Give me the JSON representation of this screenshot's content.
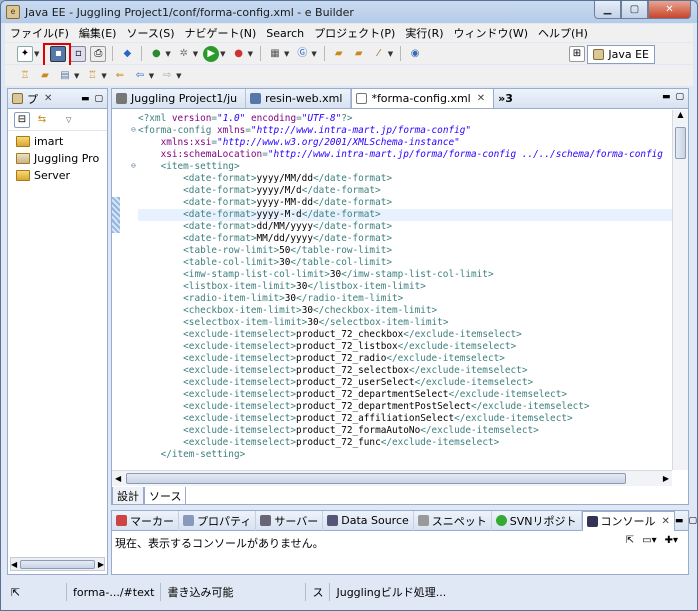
{
  "window": {
    "title": "Java EE - Juggling Project1/conf/forma-config.xml - e Builder"
  },
  "menu": [
    "ファイル(F)",
    "編集(E)",
    "ソース(S)",
    "ナビゲート(N)",
    "Search",
    "プロジェクト(P)",
    "実行(R)",
    "ウィンドウ(W)",
    "ヘルプ(H)"
  ],
  "perspective": {
    "label": "Java EE"
  },
  "explorer": {
    "tab_label": "プ",
    "items": [
      "imart",
      "Juggling Pro",
      "Server"
    ]
  },
  "editor": {
    "tabs": [
      {
        "label": "Juggling Project1/ju",
        "active": false
      },
      {
        "label": "resin-web.xml",
        "active": false
      },
      {
        "label": "*forma-config.xml",
        "active": true
      },
      {
        "label": "»3",
        "active": false
      }
    ],
    "lines": [
      [
        {
          "c": "t-tag",
          "t": "<?xml "
        },
        {
          "c": "t-attr",
          "t": "version"
        },
        {
          "c": "t-tag",
          "t": "="
        },
        {
          "c": "t-val",
          "t": "\"1.0\""
        },
        {
          "c": "t-tag",
          "t": " "
        },
        {
          "c": "t-attr",
          "t": "encoding"
        },
        {
          "c": "t-tag",
          "t": "="
        },
        {
          "c": "t-val",
          "t": "\"UTF-8\""
        },
        {
          "c": "t-tag",
          "t": "?>"
        }
      ],
      [
        {
          "c": "t-tag",
          "t": "<forma-config "
        },
        {
          "c": "t-attr",
          "t": "xmlns"
        },
        {
          "c": "t-tag",
          "t": "="
        },
        {
          "c": "t-val",
          "t": "\"http://www.intra-mart.jp/forma-config\""
        }
      ],
      [
        {
          "c": "t-txt",
          "t": "    "
        },
        {
          "c": "t-attr",
          "t": "xmlns:xsi"
        },
        {
          "c": "t-tag",
          "t": "="
        },
        {
          "c": "t-val",
          "t": "\"http://www.w3.org/2001/XMLSchema-instance\""
        }
      ],
      [
        {
          "c": "t-txt",
          "t": "    "
        },
        {
          "c": "t-attr",
          "t": "xsi:schemaLocation"
        },
        {
          "c": "t-tag",
          "t": "="
        },
        {
          "c": "t-val",
          "t": "\"http://www.intra-mart.jp/forma/forma-config ../../schema/forma-config"
        }
      ],
      [
        {
          "c": "t-txt",
          "t": "    "
        },
        {
          "c": "t-tag",
          "t": "<item-setting>"
        }
      ],
      [
        {
          "c": "t-txt",
          "t": "        "
        },
        {
          "c": "t-tag",
          "t": "<date-format>"
        },
        {
          "c": "t-txt",
          "t": "yyyy/MM/dd"
        },
        {
          "c": "t-tag",
          "t": "</date-format>"
        }
      ],
      [
        {
          "c": "t-txt",
          "t": "        "
        },
        {
          "c": "t-tag",
          "t": "<date-format>"
        },
        {
          "c": "t-txt",
          "t": "yyyy/M/d"
        },
        {
          "c": "t-tag",
          "t": "</date-format>"
        }
      ],
      [
        {
          "c": "t-txt",
          "t": "        "
        },
        {
          "c": "t-tag",
          "t": "<date-format>"
        },
        {
          "c": "t-txt",
          "t": "yyyy-MM-dd"
        },
        {
          "c": "t-tag",
          "t": "</date-format>"
        }
      ],
      [
        {
          "c": "t-txt",
          "t": "        "
        },
        {
          "c": "t-tag",
          "t": "<date-format>"
        },
        {
          "c": "t-txt",
          "t": "yyyy-M-d"
        },
        {
          "c": "t-tag",
          "t": "</date-format>"
        }
      ],
      [
        {
          "c": "t-txt",
          "t": "        "
        },
        {
          "c": "t-tag",
          "t": "<date-format>"
        },
        {
          "c": "t-txt",
          "t": "dd/MM/yyyy"
        },
        {
          "c": "t-tag",
          "t": "</date-format>"
        }
      ],
      [
        {
          "c": "t-txt",
          "t": "        "
        },
        {
          "c": "t-tag",
          "t": "<date-format>"
        },
        {
          "c": "t-txt",
          "t": "MM/dd/yyyy"
        },
        {
          "c": "t-tag",
          "t": "</date-format>"
        }
      ],
      [
        {
          "c": "t-txt",
          "t": "        "
        },
        {
          "c": "t-tag",
          "t": "<table-row-limit>"
        },
        {
          "c": "t-txt",
          "t": "50"
        },
        {
          "c": "t-tag",
          "t": "</table-row-limit>"
        }
      ],
      [
        {
          "c": "t-txt",
          "t": "        "
        },
        {
          "c": "t-tag",
          "t": "<table-col-limit>"
        },
        {
          "c": "t-txt",
          "t": "30"
        },
        {
          "c": "t-tag",
          "t": "</table-col-limit>"
        }
      ],
      [
        {
          "c": "t-txt",
          "t": "        "
        },
        {
          "c": "t-tag",
          "t": "<imw-stamp-list-col-limit>"
        },
        {
          "c": "t-txt",
          "t": "30"
        },
        {
          "c": "t-tag",
          "t": "</imw-stamp-list-col-limit>"
        }
      ],
      [
        {
          "c": "t-txt",
          "t": "        "
        },
        {
          "c": "t-tag",
          "t": "<listbox-item-limit>"
        },
        {
          "c": "t-txt",
          "t": "30"
        },
        {
          "c": "t-tag",
          "t": "</listbox-item-limit>"
        }
      ],
      [
        {
          "c": "t-txt",
          "t": "        "
        },
        {
          "c": "t-tag",
          "t": "<radio-item-limit>"
        },
        {
          "c": "t-txt",
          "t": "30"
        },
        {
          "c": "t-tag",
          "t": "</radio-item-limit>"
        }
      ],
      [
        {
          "c": "t-txt",
          "t": "        "
        },
        {
          "c": "t-tag",
          "t": "<checkbox-item-limit>"
        },
        {
          "c": "t-txt",
          "t": "30"
        },
        {
          "c": "t-tag",
          "t": "</checkbox-item-limit>"
        }
      ],
      [
        {
          "c": "t-txt",
          "t": "        "
        },
        {
          "c": "t-tag",
          "t": "<selectbox-item-limit>"
        },
        {
          "c": "t-txt",
          "t": "30"
        },
        {
          "c": "t-tag",
          "t": "</selectbox-item-limit>"
        }
      ],
      [
        {
          "c": "t-txt",
          "t": "        "
        },
        {
          "c": "t-tag",
          "t": "<exclude-itemselect>"
        },
        {
          "c": "t-txt",
          "t": "product_72_checkbox"
        },
        {
          "c": "t-tag",
          "t": "</exclude-itemselect>"
        }
      ],
      [
        {
          "c": "t-txt",
          "t": "        "
        },
        {
          "c": "t-tag",
          "t": "<exclude-itemselect>"
        },
        {
          "c": "t-txt",
          "t": "product_72_listbox"
        },
        {
          "c": "t-tag",
          "t": "</exclude-itemselect>"
        }
      ],
      [
        {
          "c": "t-txt",
          "t": "        "
        },
        {
          "c": "t-tag",
          "t": "<exclude-itemselect>"
        },
        {
          "c": "t-txt",
          "t": "product_72_radio"
        },
        {
          "c": "t-tag",
          "t": "</exclude-itemselect>"
        }
      ],
      [
        {
          "c": "t-txt",
          "t": "        "
        },
        {
          "c": "t-tag",
          "t": "<exclude-itemselect>"
        },
        {
          "c": "t-txt",
          "t": "product_72_selectbox"
        },
        {
          "c": "t-tag",
          "t": "</exclude-itemselect>"
        }
      ],
      [
        {
          "c": "t-txt",
          "t": "        "
        },
        {
          "c": "t-tag",
          "t": "<exclude-itemselect>"
        },
        {
          "c": "t-txt",
          "t": "product_72_userSelect"
        },
        {
          "c": "t-tag",
          "t": "</exclude-itemselect>"
        }
      ],
      [
        {
          "c": "t-txt",
          "t": "        "
        },
        {
          "c": "t-tag",
          "t": "<exclude-itemselect>"
        },
        {
          "c": "t-txt",
          "t": "product_72_departmentSelect"
        },
        {
          "c": "t-tag",
          "t": "</exclude-itemselect>"
        }
      ],
      [
        {
          "c": "t-txt",
          "t": "        "
        },
        {
          "c": "t-tag",
          "t": "<exclude-itemselect>"
        },
        {
          "c": "t-txt",
          "t": "product_72_departmentPostSelect"
        },
        {
          "c": "t-tag",
          "t": "</exclude-itemselect>"
        }
      ],
      [
        {
          "c": "t-txt",
          "t": "        "
        },
        {
          "c": "t-tag",
          "t": "<exclude-itemselect>"
        },
        {
          "c": "t-txt",
          "t": "product_72_affiliationSelect"
        },
        {
          "c": "t-tag",
          "t": "</exclude-itemselect>"
        }
      ],
      [
        {
          "c": "t-txt",
          "t": "        "
        },
        {
          "c": "t-tag",
          "t": "<exclude-itemselect>"
        },
        {
          "c": "t-txt",
          "t": "product_72_formaAutoNo"
        },
        {
          "c": "t-tag",
          "t": "</exclude-itemselect>"
        }
      ],
      [
        {
          "c": "t-txt",
          "t": "        "
        },
        {
          "c": "t-tag",
          "t": "<exclude-itemselect>"
        },
        {
          "c": "t-txt",
          "t": "product_72_func"
        },
        {
          "c": "t-tag",
          "t": "</exclude-itemselect>"
        }
      ],
      [
        {
          "c": "t-txt",
          "t": "    "
        },
        {
          "c": "t-tag",
          "t": "</item-setting>"
        }
      ]
    ],
    "current_line": 8,
    "design_tabs": [
      "設計",
      "ソース"
    ]
  },
  "console": {
    "tabs": [
      "マーカー",
      "プロパティ",
      "サーバー",
      "Data Source",
      "スニペット",
      "SVNリポジト",
      "コンソール"
    ],
    "message": "現在、表示するコンソールがありません。"
  },
  "status": {
    "item1": "forma-.../#text",
    "item2": "書き込み可能",
    "item3": "ス",
    "item4": "Jugglingビルド処理..."
  }
}
